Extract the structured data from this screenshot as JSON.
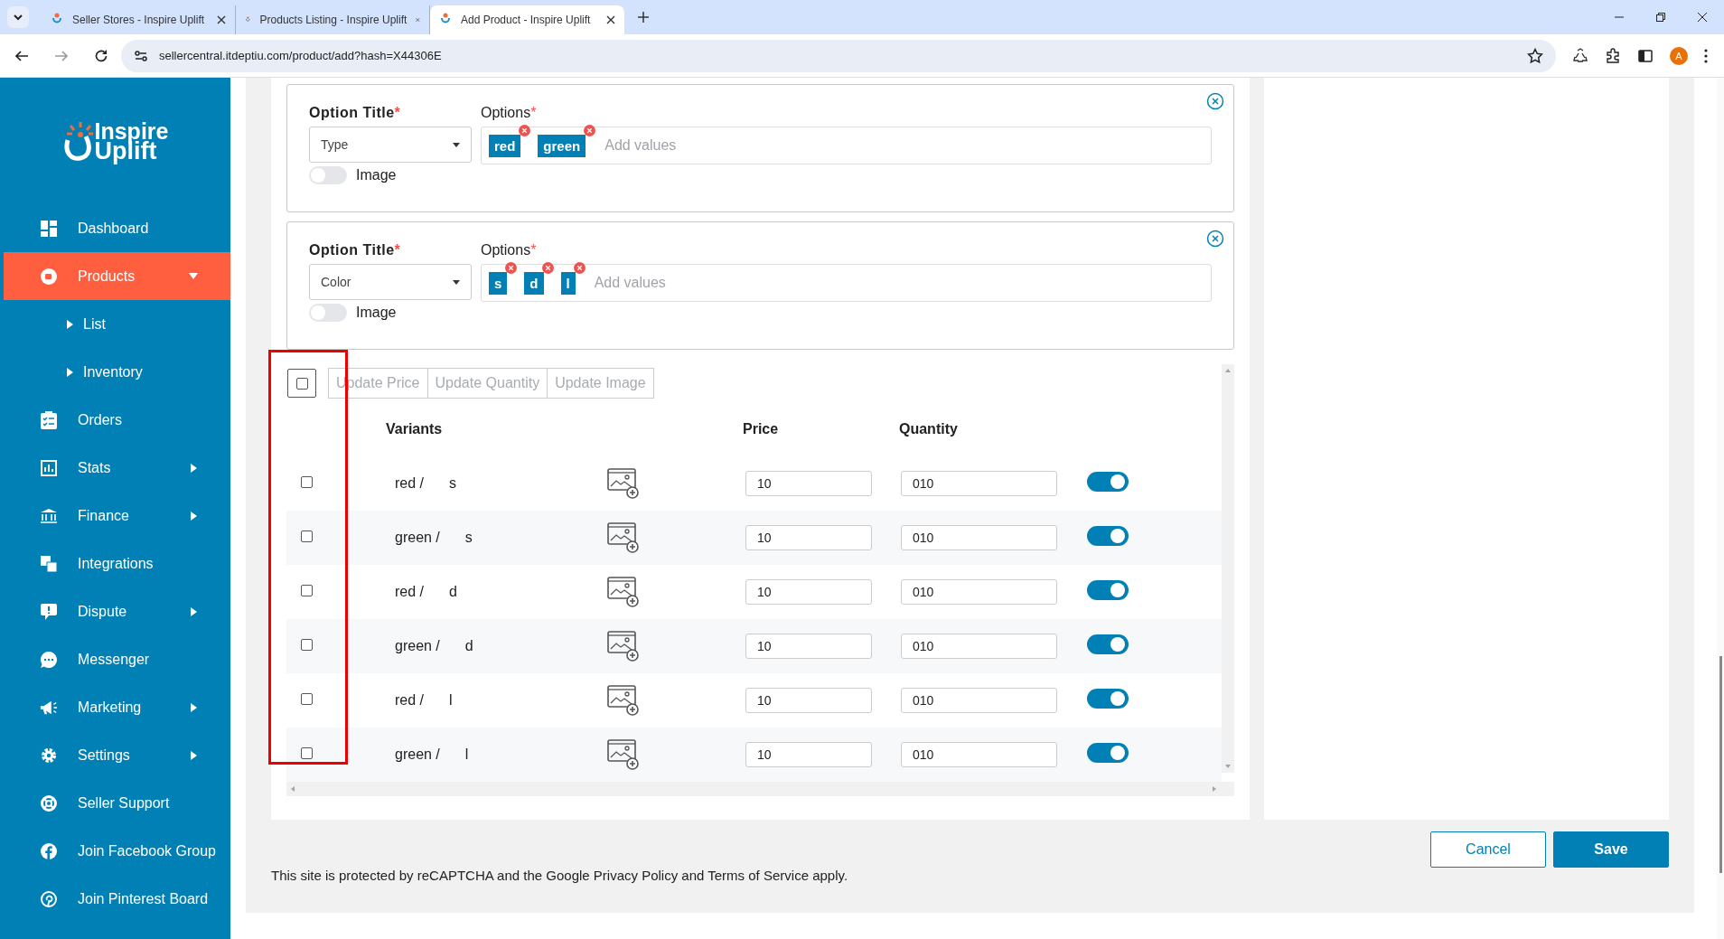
{
  "browser": {
    "tabs": [
      {
        "title": "Seller Stores - Inspire Uplift",
        "selected": false
      },
      {
        "title": "Products Listing - Inspire Uplift",
        "selected": false
      },
      {
        "title": "Add Product - Inspire Uplift",
        "selected": true
      }
    ],
    "url": "sellercentral.itdeptiu.com/product/add?hash=X44306E",
    "avatar": "A"
  },
  "logo": {
    "line1": "Inspire",
    "line2": "Uplift"
  },
  "sidebar": {
    "items": [
      {
        "label": "Dashboard",
        "selected": false
      },
      {
        "label": "Products",
        "selected": true,
        "expanded": true,
        "children": [
          {
            "label": "List"
          },
          {
            "label": "Inventory"
          }
        ]
      },
      {
        "label": "Orders",
        "selected": false
      },
      {
        "label": "Stats",
        "selected": false,
        "expanded": false
      },
      {
        "label": "Finance",
        "selected": false,
        "expanded": false
      },
      {
        "label": "Integrations",
        "selected": false
      },
      {
        "label": "Dispute",
        "selected": false,
        "expanded": false
      },
      {
        "label": "Messenger",
        "selected": false
      },
      {
        "label": "Marketing",
        "selected": false,
        "expanded": false
      },
      {
        "label": "Settings",
        "selected": false,
        "expanded": false
      },
      {
        "label": "Seller Support",
        "selected": false
      },
      {
        "label": "Join Facebook Group",
        "selected": false
      },
      {
        "label": "Join Pinterest Board",
        "selected": false
      }
    ]
  },
  "options": [
    {
      "title_label": "Option Title",
      "required_mark": "*",
      "title_value": "Type",
      "options_label": "Options",
      "values": [
        "red",
        "green"
      ],
      "placeholder": "Add values",
      "image_label": "Image",
      "image_on": false
    },
    {
      "title_label": "Option Title",
      "required_mark": "*",
      "title_value": "Color",
      "options_label": "Options",
      "values": [
        "s",
        "d",
        "l"
      ],
      "placeholder": "Add values",
      "image_label": "Image",
      "image_on": false
    }
  ],
  "variants": {
    "select_all_checked": false,
    "actions": [
      {
        "label": "Update Price",
        "disabled": true
      },
      {
        "label": "Update Quantity",
        "disabled": true
      },
      {
        "label": "Update Image",
        "disabled": true
      }
    ],
    "columns": [
      "Variants",
      "Price",
      "Quantity"
    ],
    "rows": [
      {
        "checked": false,
        "variant": [
          "red /",
          "s"
        ],
        "price": "10",
        "quantity": "010",
        "enabled": true
      },
      {
        "checked": false,
        "variant": [
          "green /",
          "s"
        ],
        "price": "10",
        "quantity": "010",
        "enabled": true
      },
      {
        "checked": false,
        "variant": [
          "red /",
          "d"
        ],
        "price": "10",
        "quantity": "010",
        "enabled": true
      },
      {
        "checked": false,
        "variant": [
          "green /",
          "d"
        ],
        "price": "10",
        "quantity": "010",
        "enabled": true
      },
      {
        "checked": false,
        "variant": [
          "red /",
          "l"
        ],
        "price": "10",
        "quantity": "010",
        "enabled": true
      },
      {
        "checked": false,
        "variant": [
          "green /",
          "l"
        ],
        "price": "10",
        "quantity": "010",
        "enabled": true
      }
    ]
  },
  "footer": {
    "cancel": "Cancel",
    "save": "Save",
    "notice": "This site is protected by reCAPTCHA and the Google Privacy Policy and Terms of Service apply."
  }
}
